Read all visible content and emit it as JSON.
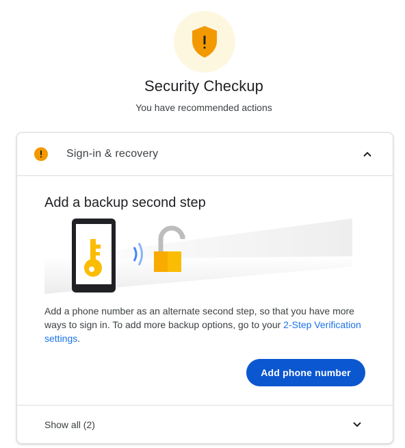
{
  "header": {
    "title": "Security Checkup",
    "subtitle": "You have recommended actions",
    "shield_icon": "warning-shield-icon",
    "shield_color": "#f29900",
    "shield_bg": "#fef7e0"
  },
  "section": {
    "title": "Sign-in & recovery",
    "status_icon": "warning-icon",
    "expanded": true
  },
  "step": {
    "title": "Add a backup second step",
    "description_prefix": "Add a phone number as an alternate second step, so that you have more ways to sign in. To add more backup options, go to your ",
    "link_text": "2-Step Verification settings",
    "description_suffix": ".",
    "button_label": "Add phone number"
  },
  "footer": {
    "show_all_label": "Show all (2)"
  },
  "colors": {
    "accent": "#0b57d0",
    "link": "#1a73e8",
    "warning": "#f29900",
    "key_yellow": "#fbbc04"
  }
}
